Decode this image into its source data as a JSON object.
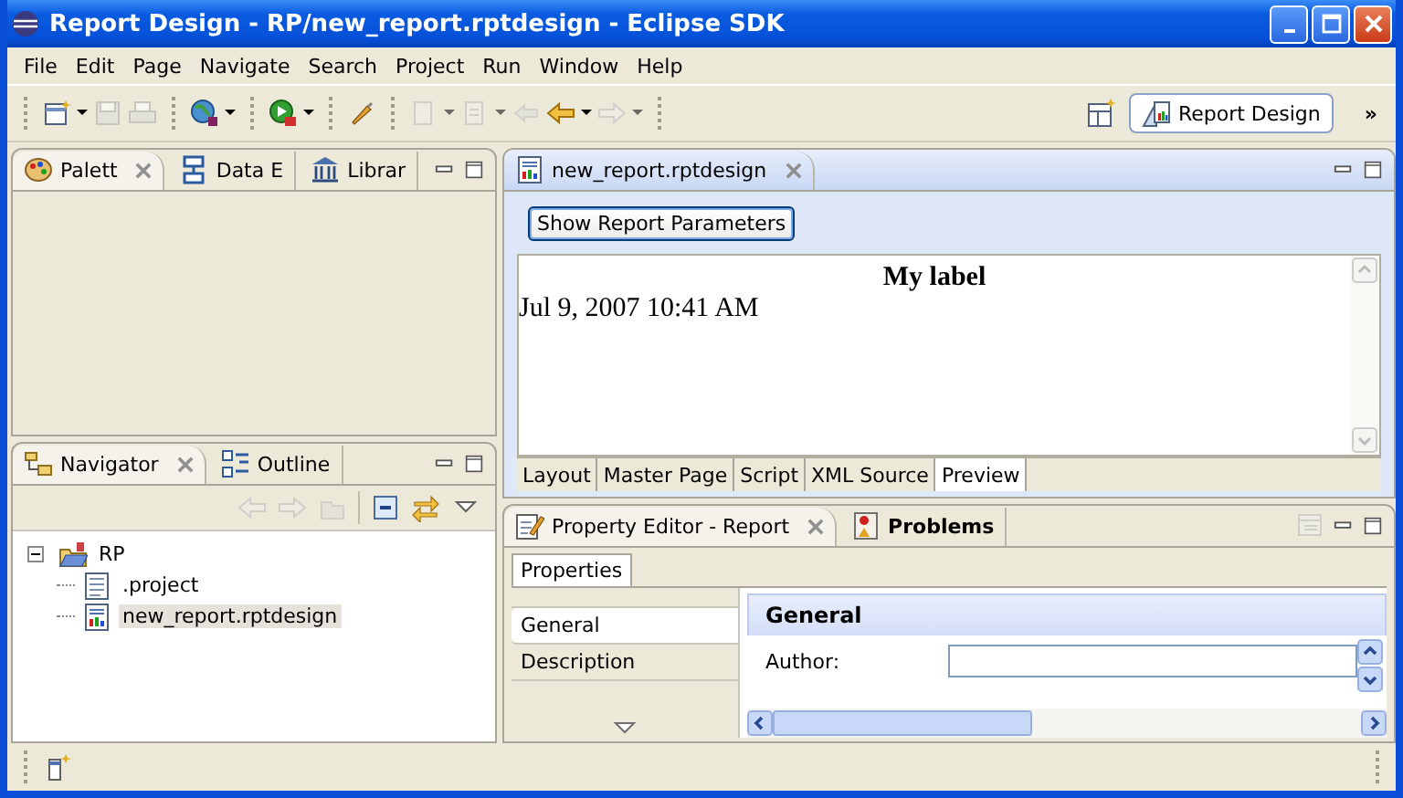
{
  "window": {
    "title": "Report Design - RP/new_report.rptdesign - Eclipse SDK"
  },
  "menu": [
    "File",
    "Edit",
    "Page",
    "Navigate",
    "Search",
    "Project",
    "Run",
    "Window",
    "Help"
  ],
  "toolbar": {
    "perspective_button": "Report Design",
    "overflow": "»"
  },
  "palette_panel": {
    "tabs": [
      {
        "label": "Palett",
        "selected": true
      },
      {
        "label": "Data E",
        "selected": false
      },
      {
        "label": "Librar",
        "selected": false
      }
    ]
  },
  "navigator_panel": {
    "tabs": [
      {
        "label": "Navigator",
        "selected": true
      },
      {
        "label": "Outline",
        "selected": false
      }
    ],
    "tree": [
      {
        "label": "RP",
        "kind": "project",
        "expanded": true,
        "selected": false,
        "children": [
          {
            "label": ".project",
            "kind": "file",
            "selected": false
          },
          {
            "label": "new_report.rptdesign",
            "kind": "report",
            "selected": true
          }
        ]
      }
    ]
  },
  "editor": {
    "tab": {
      "label": "new_report.rptdesign"
    },
    "button": "Show Report Parameters",
    "preview": {
      "heading": "My label",
      "date": "Jul 9, 2007 10:41 AM"
    },
    "tabs": [
      {
        "label": "Layout",
        "selected": false
      },
      {
        "label": "Master Page",
        "selected": false
      },
      {
        "label": "Script",
        "selected": false
      },
      {
        "label": "XML Source",
        "selected": false
      },
      {
        "label": "Preview",
        "selected": true
      }
    ]
  },
  "property_panel": {
    "tabs": [
      {
        "label": "Property Editor - Report",
        "selected": true,
        "bold": false
      },
      {
        "label": "Problems",
        "selected": false,
        "bold": true
      }
    ],
    "subtab": {
      "label": "Properties",
      "selected": true
    },
    "categories": [
      {
        "label": "General",
        "selected": true
      },
      {
        "label": "Description",
        "selected": false
      }
    ],
    "section_title": "General",
    "fields": [
      {
        "label": "Author:"
      }
    ]
  }
}
